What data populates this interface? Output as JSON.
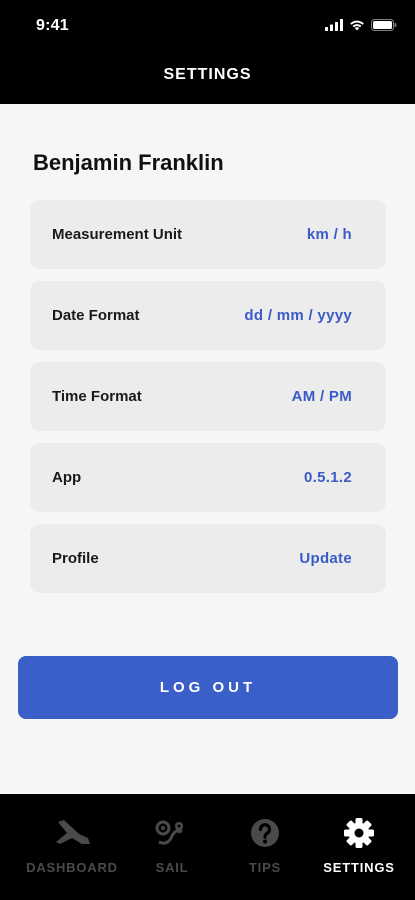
{
  "status_bar": {
    "time": "9:41"
  },
  "header": {
    "title": "SETTINGS"
  },
  "user": {
    "name": "Benjamin Franklin"
  },
  "settings": [
    {
      "label": "Measurement Unit",
      "value": "km / h"
    },
    {
      "label": "Date Format",
      "value": "dd / mm / yyyy"
    },
    {
      "label": "Time Format",
      "value": "AM / PM"
    },
    {
      "label": "App",
      "value": "0.5.1.2"
    },
    {
      "label": "Profile",
      "value": "Update"
    }
  ],
  "logout": {
    "label": "LOG OUT"
  },
  "tabs": [
    {
      "label": "DASHBOARD",
      "icon": "dashboard-icon",
      "active": false
    },
    {
      "label": "SAIL",
      "icon": "sail-route-icon",
      "active": false
    },
    {
      "label": "TIPS",
      "icon": "help-icon",
      "active": false
    },
    {
      "label": "SETTINGS",
      "icon": "gear-icon",
      "active": true
    }
  ],
  "colors": {
    "accent": "#3b5fc9",
    "value_text": "#3a5bc7",
    "header_bg": "#000000",
    "row_bg": "#ececec",
    "inactive_tab": "#4a4a4a",
    "active_tab": "#ffffff"
  }
}
